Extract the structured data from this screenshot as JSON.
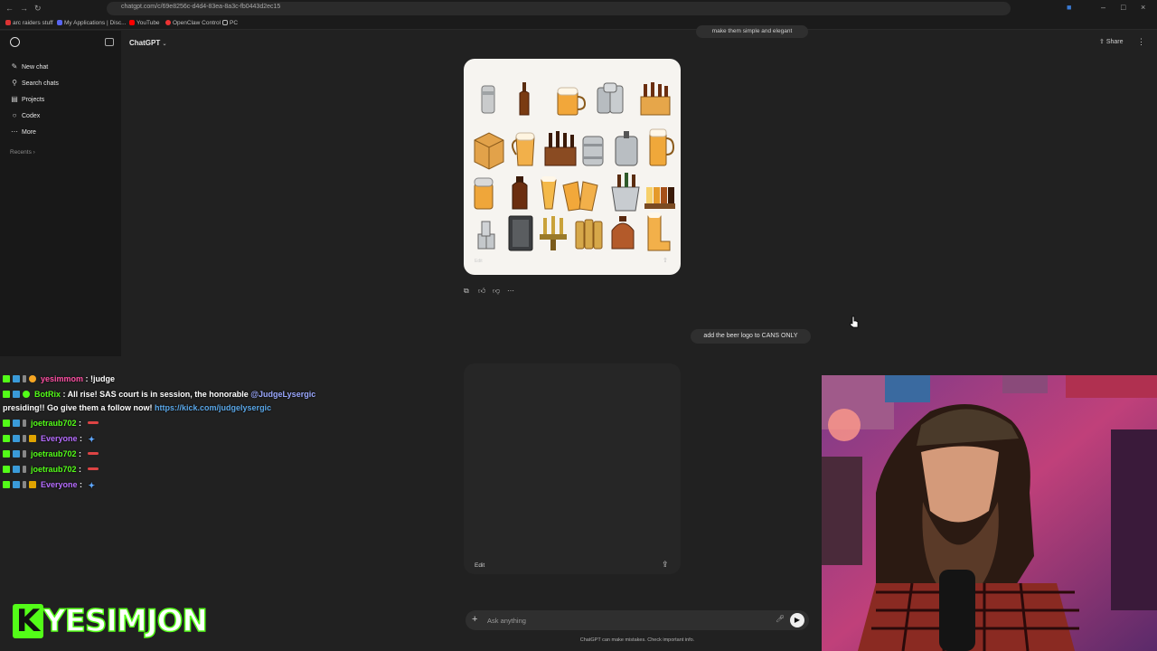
{
  "browser": {
    "url": "chatgpt.com/c/69e8256c-d4d4-83ea-8a3c-fb0443d2ec15",
    "bookmarks": [
      "arc raiders stuff",
      "My Applications | Disc...",
      "YouTube",
      "OpenClaw Control",
      "PC"
    ]
  },
  "sidebar": {
    "items": [
      {
        "label": "New chat",
        "icon": "new-chat-icon"
      },
      {
        "label": "Search chats",
        "icon": "search-icon"
      },
      {
        "label": "Projects",
        "icon": "folder-icon"
      },
      {
        "label": "Codex",
        "icon": "codex-icon"
      },
      {
        "label": "More",
        "icon": "more-dots-icon"
      }
    ],
    "recents_label": "Recents"
  },
  "header": {
    "model": "ChatGPT",
    "share_label": "Share"
  },
  "chat": {
    "previous_user_message": "make them simple and elegant",
    "generated_image_edit": "Edit",
    "user_message": "add the beer logo to CANS ONLY",
    "pending_image_edit": "Edit"
  },
  "composer": {
    "placeholder": "Ask anything",
    "disclaimer": "ChatGPT can make mistakes. Check important info."
  },
  "stream_chat": [
    {
      "user": "yesimmom",
      "user_color": "#ff4fa3",
      "message": "!judge"
    },
    {
      "user": "BotRix",
      "user_color": "#53fc18",
      "message": "All rise! SAS court is in session, the honorable",
      "mention": "@JudgeLysergic",
      "message2": "presiding!! Go give them a follow now!",
      "link": "https://kick.com/judgelysergic"
    },
    {
      "user": "joetraub702",
      "user_color": "#53fc18",
      "message": ""
    },
    {
      "user": "Everyone",
      "user_color": "#b66cff",
      "message": ""
    },
    {
      "user": "joetraub702",
      "user_color": "#53fc18",
      "message": ""
    },
    {
      "user": "joetraub702",
      "user_color": "#53fc18",
      "message": ""
    },
    {
      "user": "Everyone",
      "user_color": "#b66cff",
      "message": ""
    }
  ],
  "branding": {
    "letter": "K",
    "name": "YESIMJON"
  }
}
